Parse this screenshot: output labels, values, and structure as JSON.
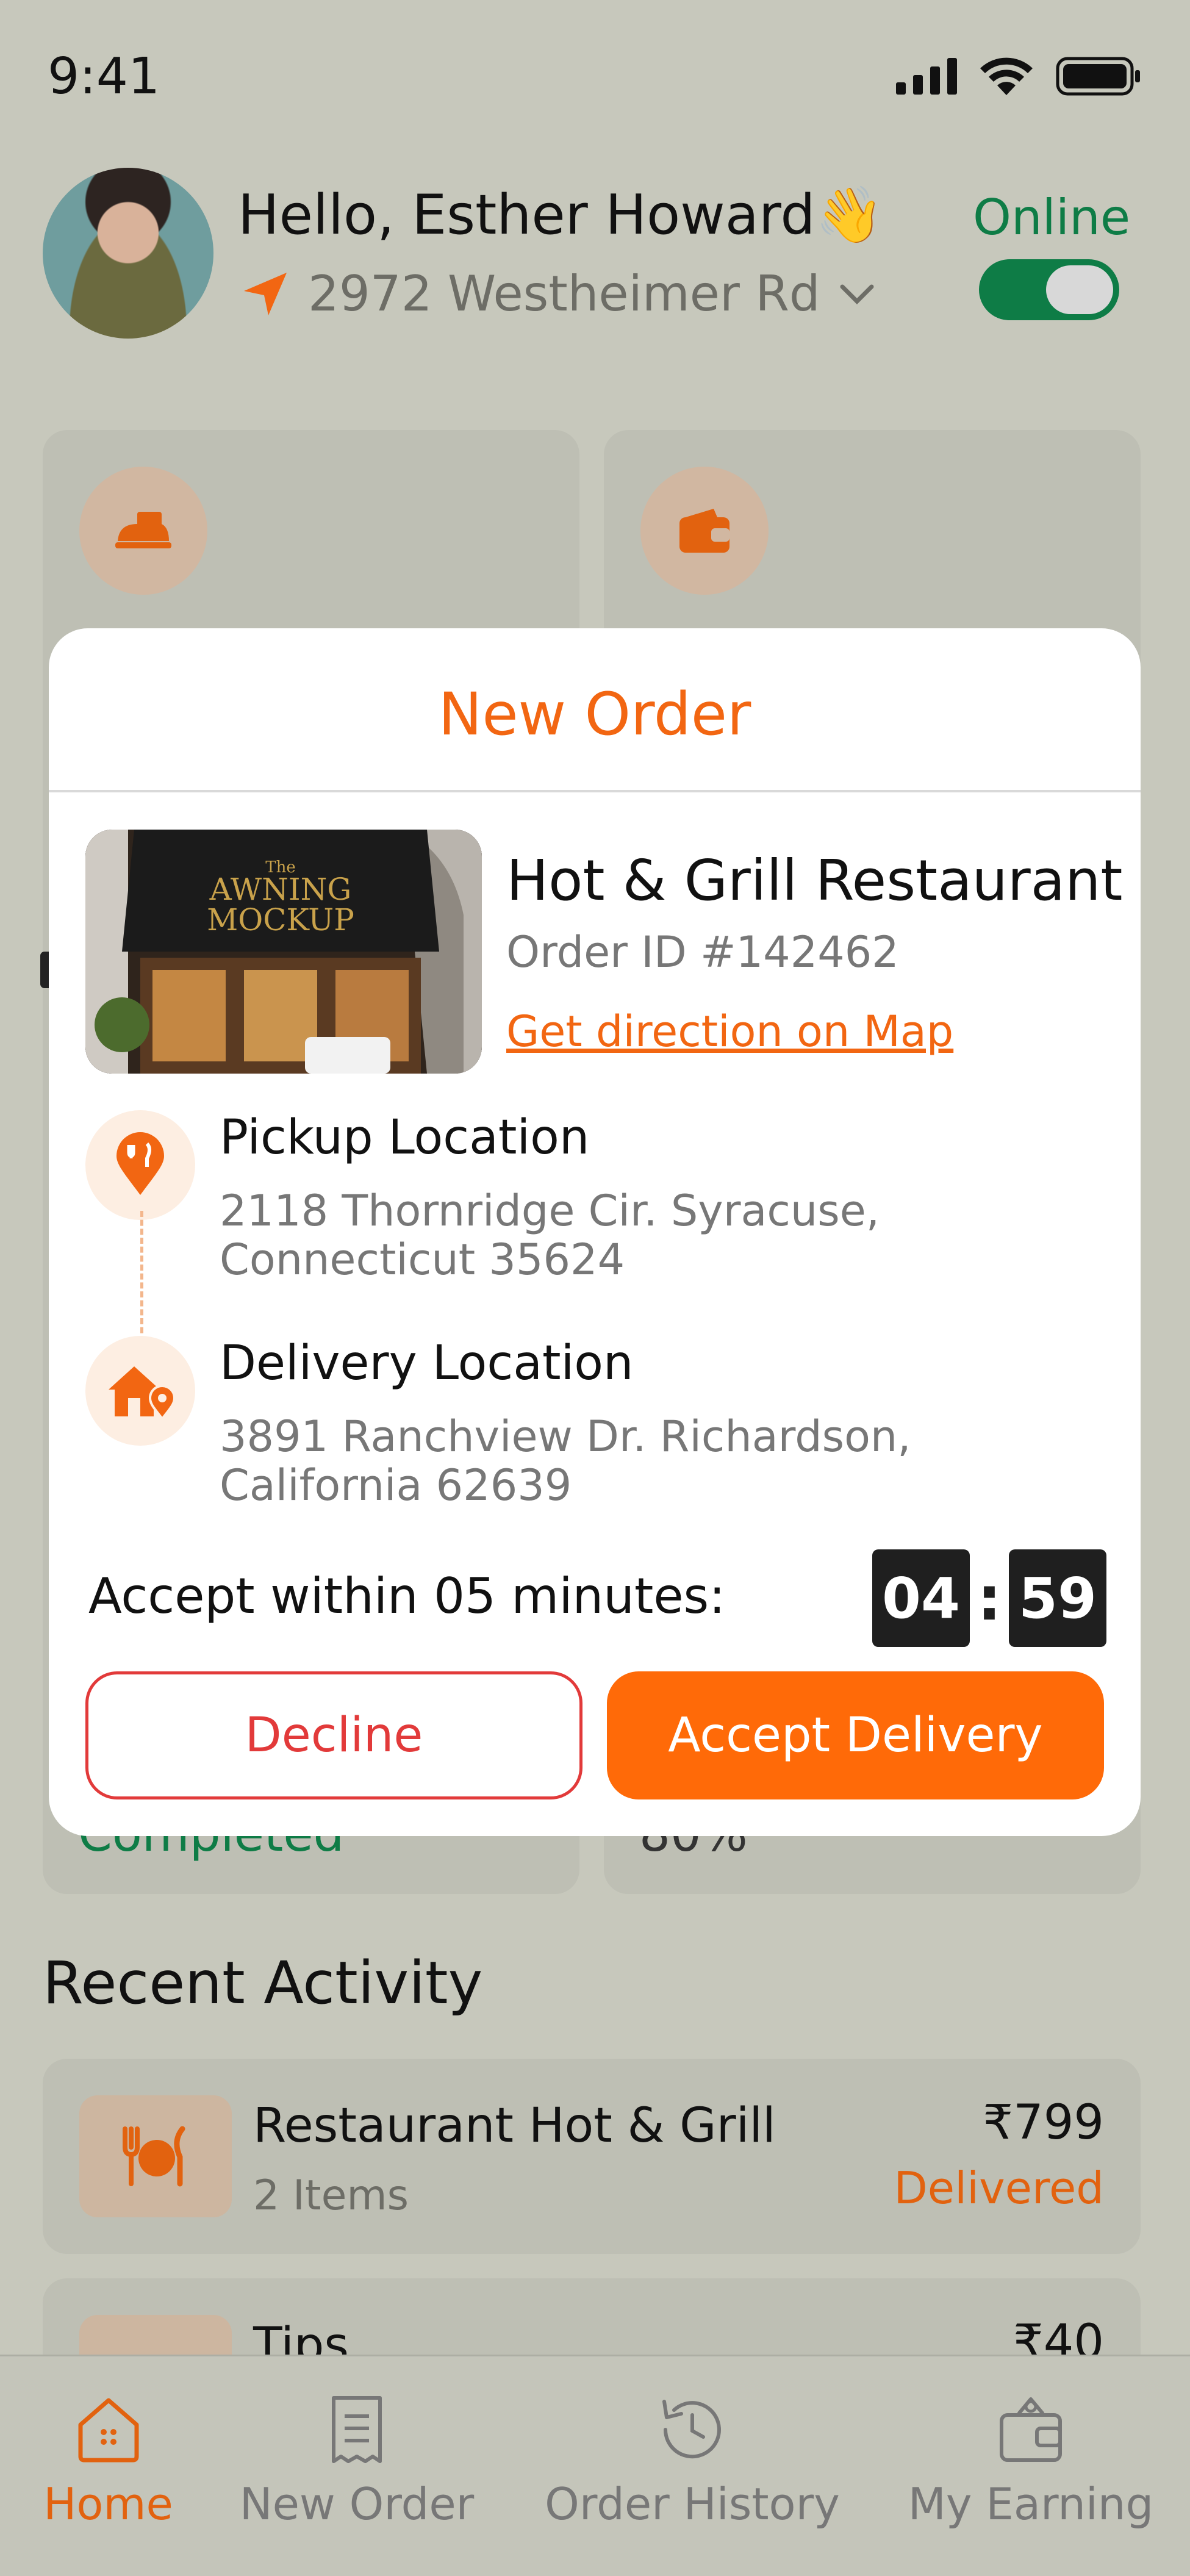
{
  "status_bar": {
    "time": "9:41"
  },
  "header": {
    "greeting": "Hello, Esther Howard",
    "wave_emoji": "👋",
    "address": "2972 Westheimer Rd",
    "online_label": "Online",
    "online": true
  },
  "stats": {
    "card1_bottom_text": "Completed",
    "card2_bottom_text": "80%"
  },
  "modal": {
    "title": "New Order",
    "restaurant_name": "Hot & Grill Restaurant",
    "order_id": "Order ID #142462",
    "map_link": "Get direction on Map",
    "image_sign_line1": "The",
    "image_sign_line2": "AWNING",
    "image_sign_line3": "MOCKUP",
    "pickup": {
      "title": "Pickup Location",
      "address": "2118 Thornridge Cir. Syracuse, Connecticut 35624"
    },
    "delivery": {
      "title": "Delivery Location",
      "address": "3891 Ranchview Dr. Richardson, California 62639"
    },
    "accept_within": "Accept within 05 minutes:",
    "timer_minutes": "04",
    "timer_separator": ":",
    "timer_seconds": "59",
    "decline_label": "Decline",
    "accept_label": "Accept Delivery"
  },
  "recent": {
    "title": "Recent Activity",
    "items": [
      {
        "name": "Restaurant Hot & Grill",
        "sub": "2 Items",
        "amount": "₹799",
        "status": "Delivered"
      },
      {
        "name": "Tips",
        "amount": "₹40"
      }
    ]
  },
  "nav": {
    "items": [
      {
        "label": "Home",
        "active": true
      },
      {
        "label": "New Order"
      },
      {
        "label": "Order History"
      },
      {
        "label": "My Earning"
      }
    ]
  },
  "colors": {
    "accent": "#F26612",
    "online_green": "#0E7C46",
    "decline_red": "#E23A3A",
    "overlay": "#C7C8BC"
  }
}
